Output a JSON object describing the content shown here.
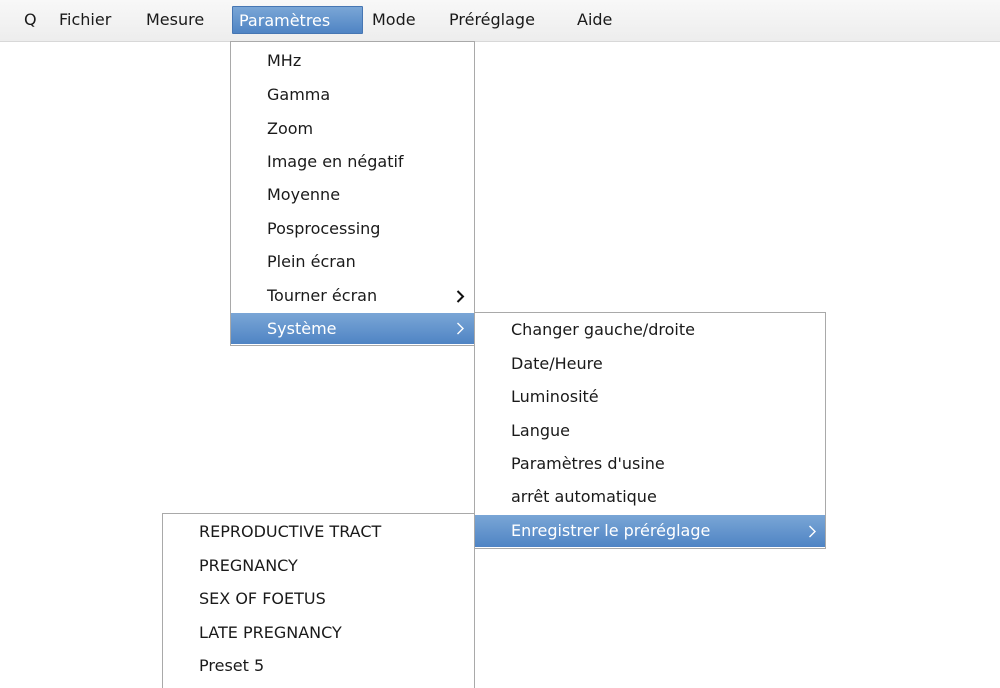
{
  "menubar": {
    "items": [
      "Q",
      "Fichier",
      "Mesure",
      "Paramètres",
      "Mode",
      "Préréglage",
      "Aide"
    ],
    "active": "Paramètres"
  },
  "parametres_menu": {
    "items": [
      "MHz",
      "Gamma",
      "Zoom",
      "Image en négatif",
      "Moyenne",
      "Posprocessing",
      "Plein écran",
      "Tourner écran",
      "Système"
    ],
    "highlighted": "Système"
  },
  "systeme_menu": {
    "items": [
      "Changer gauche/droite",
      "Date/Heure",
      "Luminosité",
      "Langue",
      "Paramètres d'usine",
      "arrêt automatique",
      "Enregistrer le préréglage"
    ],
    "highlighted": "Enregistrer le préréglage"
  },
  "preset_menu": {
    "items": [
      "REPRODUCTIVE TRACT",
      "PREGNANCY",
      "SEX OF FOETUS",
      "LATE PREGNANCY",
      "Preset 5"
    ]
  },
  "colors": {
    "highlight": "#5b8fcc",
    "menu_border": "#a9a9a9"
  }
}
